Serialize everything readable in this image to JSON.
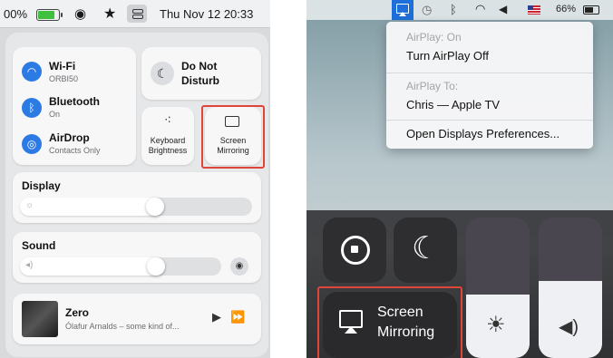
{
  "mac": {
    "menubar": {
      "battery_pct": "00%",
      "datetime": "Thu Nov 12  20:33"
    },
    "wifi": {
      "title": "Wi-Fi",
      "sub": "ORBI50"
    },
    "bluetooth": {
      "title": "Bluetooth",
      "sub": "On"
    },
    "airdrop": {
      "title": "AirDrop",
      "sub": "Contacts Only"
    },
    "dnd": {
      "line1": "Do Not",
      "line2": "Disturb"
    },
    "keyboard": {
      "line1": "Keyboard",
      "line2": "Brightness"
    },
    "mirroring": {
      "line1": "Screen",
      "line2": "Mirroring"
    },
    "display": {
      "label": "Display",
      "level": 0.62
    },
    "sound": {
      "label": "Sound",
      "level": 0.72
    },
    "music": {
      "title": "Zero",
      "artist": "Ólafur Arnalds – some kind of..."
    }
  },
  "ios": {
    "statusbar": {
      "battery": "66%"
    },
    "airplay_menu": {
      "status": "AirPlay: On",
      "toggle": "Turn AirPlay Off",
      "target_label": "AirPlay To:",
      "target": "Chris — Apple TV",
      "prefs": "Open Displays Preferences..."
    },
    "mirroring": {
      "line1": "Screen",
      "line2": "Mirroring"
    },
    "brightness_level": 0.45,
    "volume_level": 0.55
  },
  "colors": {
    "highlight": "#e0453a",
    "accent": "#2c7be5",
    "airplay_active": "#1e6fd9"
  }
}
